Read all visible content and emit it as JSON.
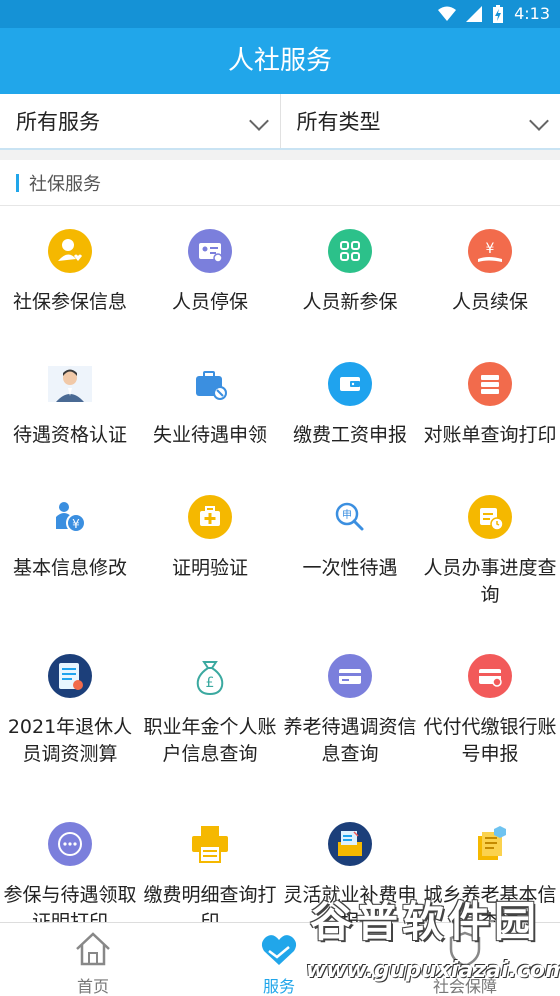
{
  "status_bar": {
    "time": "4:13"
  },
  "header": {
    "title": "人社服务"
  },
  "filters": [
    {
      "label": "所有服务"
    },
    {
      "label": "所有类型"
    }
  ],
  "section": {
    "title": "社保服务"
  },
  "services": [
    {
      "label": "社保参保信息",
      "icon": "user-heart-icon",
      "color": "#f5b800"
    },
    {
      "label": "人员停保",
      "icon": "id-card-icon",
      "color": "#7b7fdc"
    },
    {
      "label": "人员新参保",
      "icon": "grid-apps-icon",
      "color": "#2cc18a"
    },
    {
      "label": "人员续保",
      "icon": "yuan-hand-icon",
      "color": "#f26b4c"
    },
    {
      "label": "待遇资格认证",
      "icon": "face-photo-icon",
      "color": "#4a6a94"
    },
    {
      "label": "失业待遇申领",
      "icon": "briefcase-icon",
      "color": "#3b8fe0"
    },
    {
      "label": "缴费工资申报",
      "icon": "wallet-icon",
      "color": "#1fa3ee"
    },
    {
      "label": "对账单查询打印",
      "icon": "stack-icon",
      "color": "#f26b4c"
    },
    {
      "label": "基本信息修改",
      "icon": "person-yuan-icon",
      "color": "#3b8fe0"
    },
    {
      "label": "证明验证",
      "icon": "medkit-icon",
      "color": "#f5b800"
    },
    {
      "label": "一次性待遇",
      "icon": "search-shen-icon",
      "color": "#3b8fe0"
    },
    {
      "label": "人员办事进度查询",
      "icon": "calendar-clock-icon",
      "color": "#f5b800"
    },
    {
      "label": "2021年退休人员调资测算",
      "icon": "certificate-icon",
      "color": "#1fa3ee"
    },
    {
      "label": "职业年金个人账户信息查询",
      "icon": "money-bag-icon",
      "color": "#f5b800"
    },
    {
      "label": "养老待遇调资信息查询",
      "icon": "card-icon",
      "color": "#7b7fdc"
    },
    {
      "label": "代付代缴银行账号申报",
      "icon": "bank-card-icon",
      "color": "#f25a5a"
    },
    {
      "label": "参保与待遇领取证明打印",
      "icon": "chat-dots-icon",
      "color": "#7b7fdc"
    },
    {
      "label": "缴费明细查询打印",
      "icon": "printer-icon",
      "color": "#f5b800"
    },
    {
      "label": "灵活就业补费申报",
      "icon": "form-box-icon",
      "color": "#1fa3ee"
    },
    {
      "label": "城乡养老基本信息查询",
      "icon": "document-stack-icon",
      "color": "#f5b800"
    }
  ],
  "tabs": [
    {
      "label": "首页",
      "icon": "home-icon"
    },
    {
      "label": "服务",
      "icon": "handshake-heart-icon"
    },
    {
      "label": "社会保障",
      "icon": "shield-icon"
    }
  ],
  "watermark": {
    "title": "谷普软件园",
    "url": "www.gupuxiazai.com"
  }
}
